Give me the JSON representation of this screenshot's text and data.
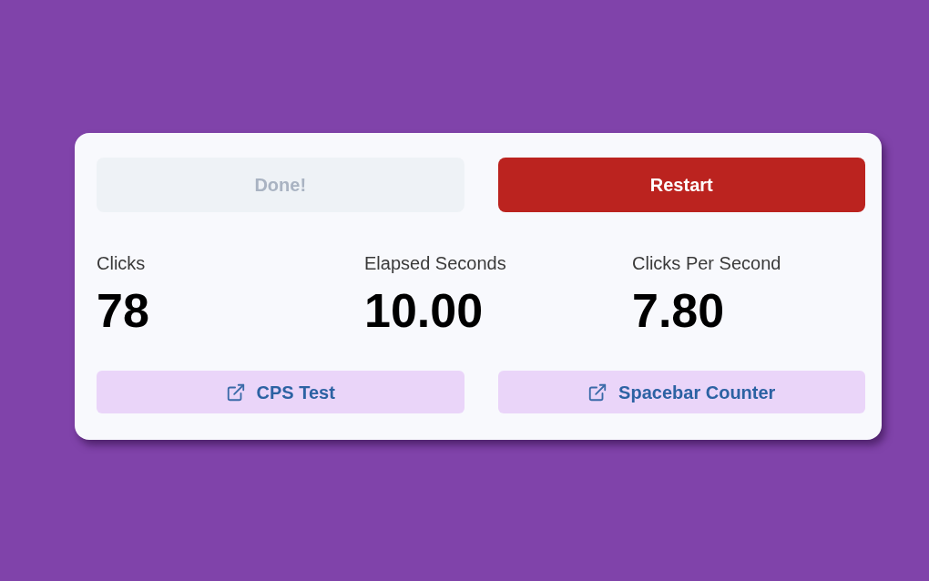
{
  "actions": [
    {
      "label": "Done!",
      "disabled": true
    },
    {
      "label": "Restart",
      "disabled": false
    }
  ],
  "stats": [
    {
      "label": "Clicks",
      "value": "78"
    },
    {
      "label": "Elapsed Seconds",
      "value": "10.00"
    },
    {
      "label": "Clicks Per Second",
      "value": "7.80"
    }
  ],
  "links": [
    {
      "label": "CPS Test"
    },
    {
      "label": "Spacebar Counter"
    }
  ]
}
